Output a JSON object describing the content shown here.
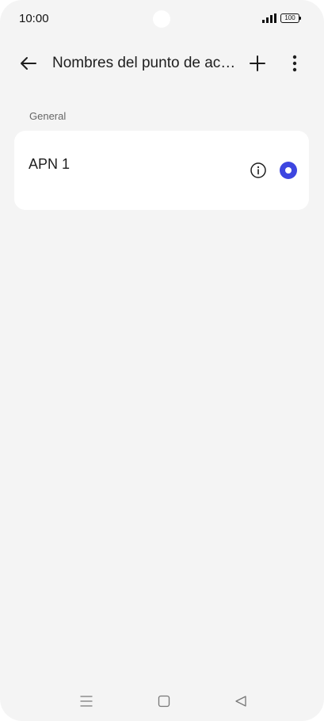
{
  "status": {
    "time": "10:00",
    "battery": "100"
  },
  "header": {
    "title": "Nombres del punto de acceso"
  },
  "section": {
    "label": "General"
  },
  "apn_list": [
    {
      "name": "APN 1",
      "selected": true
    }
  ],
  "colors": {
    "accent": "#3d46e0",
    "background": "#f4f4f4",
    "card": "#ffffff"
  },
  "icons": {
    "back": "arrow-left-icon",
    "add": "plus-icon",
    "more": "more-vertical-icon",
    "info": "info-icon",
    "nav_recent": "menu-icon",
    "nav_home": "square-icon",
    "nav_back": "triangle-back-icon"
  }
}
